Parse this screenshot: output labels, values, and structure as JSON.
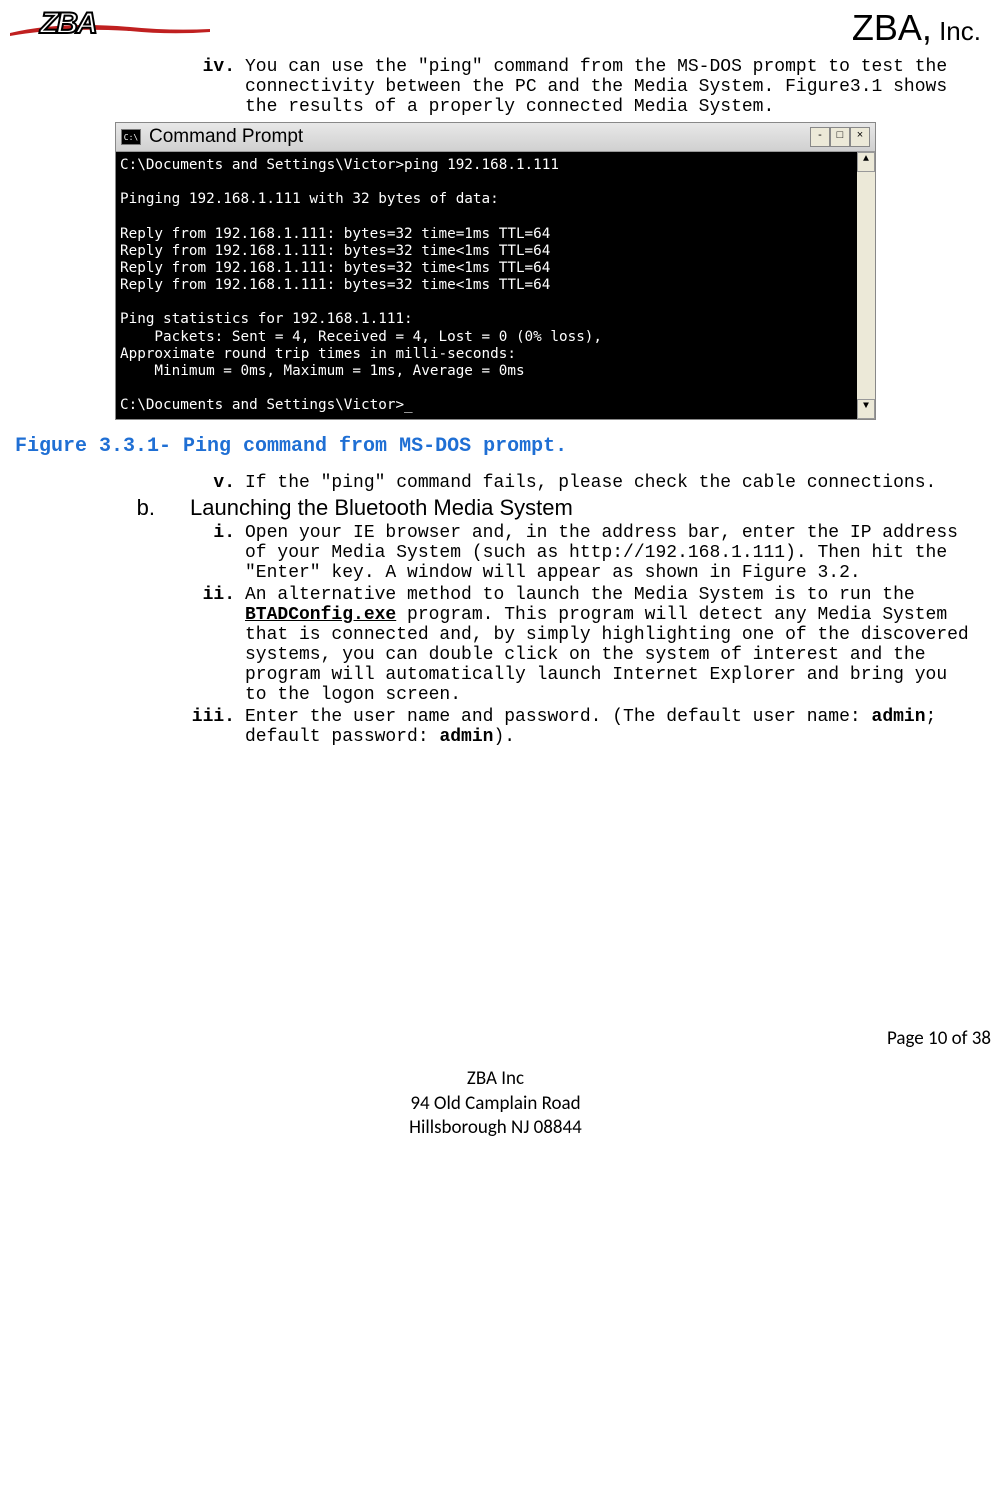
{
  "header": {
    "logo_text": "ZBA",
    "company": "ZBA,",
    "suffix": " Inc."
  },
  "items": {
    "iv": {
      "marker": "iv.",
      "text": "You can use the \"ping\" command from the MS-DOS prompt to test the connectivity between the PC and the Media System.  Figure3.1 shows the results of a properly connected Media System."
    },
    "v": {
      "marker": "v.",
      "text": "If the \"ping\" command fails, please check the cable connections."
    },
    "b": {
      "marker": "b.",
      "text": "Launching the Bluetooth Media System"
    },
    "i": {
      "marker": "i.",
      "text": "Open your IE browser and, in the address bar, enter the IP address of your Media System (such as http://192.168.1.111). Then hit the \"Enter\" key. A window will appear as shown in Figure 3.2."
    },
    "ii": {
      "marker": "ii.",
      "text_pre": "An alternative method to launch the Media System is to run the ",
      "text_bold": "BTADConfig.exe",
      "text_post": " program. This program will detect any Media System that is connected and, by simply highlighting one of the discovered systems, you can double click on the system of interest and the program will automatically launch Internet Explorer and bring you to the logon screen."
    },
    "iii": {
      "marker": "iii.",
      "text_1": "Enter the user name and password. (The default user name: ",
      "text_b1": "admin",
      "text_2": "; default password: ",
      "text_b2": "admin",
      "text_3": ")."
    }
  },
  "cmd": {
    "title": "Command Prompt",
    "body": "C:\\Documents and Settings\\Victor>ping 192.168.1.111\n\nPinging 192.168.1.111 with 32 bytes of data:\n\nReply from 192.168.1.111: bytes=32 time=1ms TTL=64\nReply from 192.168.1.111: bytes=32 time<1ms TTL=64\nReply from 192.168.1.111: bytes=32 time<1ms TTL=64\nReply from 192.168.1.111: bytes=32 time<1ms TTL=64\n\nPing statistics for 192.168.1.111:\n    Packets: Sent = 4, Received = 4, Lost = 0 (0% loss),\nApproximate round trip times in milli-seconds:\n    Minimum = 0ms, Maximum = 1ms, Average = 0ms\n\nC:\\Documents and Settings\\Victor>_"
  },
  "figure_caption": "Figure 3.3.1- Ping command from MS-DOS prompt.",
  "footer": {
    "page": "Page 10 of 38",
    "line1": "ZBA Inc",
    "line2": "94 Old Camplain Road",
    "line3": "Hillsborough NJ 08844"
  }
}
